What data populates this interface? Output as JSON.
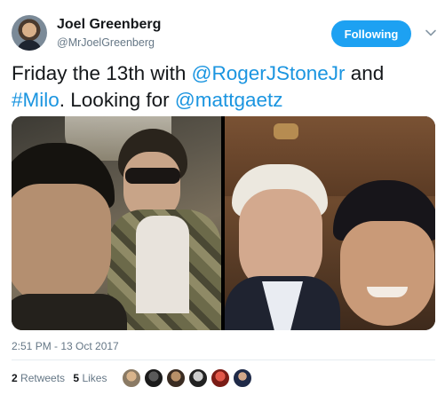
{
  "author": {
    "display_name": "Joel Greenberg",
    "handle": "@MrJoelGreenberg"
  },
  "header": {
    "follow_label": "Following"
  },
  "tweet": {
    "text_1": "Friday the 13th with ",
    "mention_1": "@RogerJStoneJr",
    "text_2": " and ",
    "hashtag_1": "#Milo",
    "text_3": ". Looking for ",
    "mention_2": "@mattgaetz"
  },
  "timestamp": "2:51 PM - 13 Oct 2017",
  "stats": {
    "retweets_count": "2",
    "retweets_label": "Retweets",
    "likes_count": "5",
    "likes_label": "Likes"
  },
  "colors": {
    "link": "#1b95e0",
    "follow_button": "#1da1f2",
    "secondary_text": "#657786"
  },
  "icons": {
    "more": "chevron-down-icon"
  }
}
